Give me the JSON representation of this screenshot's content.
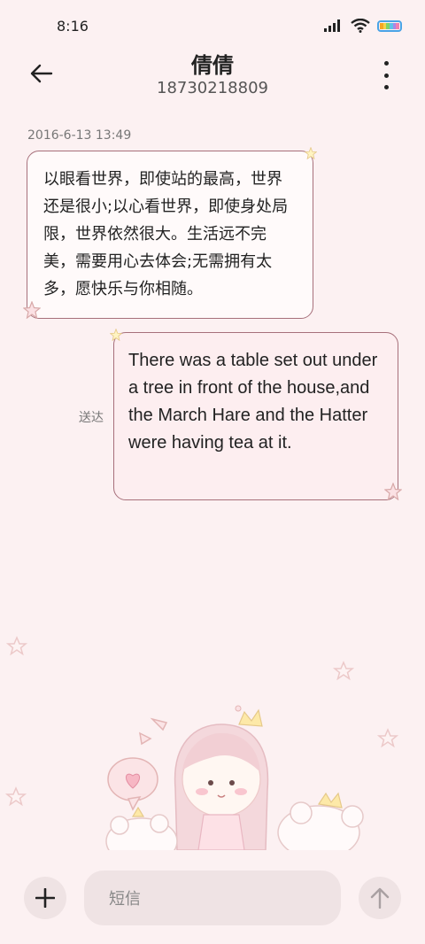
{
  "status_bar": {
    "time": "8:16",
    "icons": [
      "signal-icon",
      "wifi-icon",
      "battery-icon"
    ]
  },
  "header": {
    "contact_name": "倩倩",
    "phone_number": "18730218809"
  },
  "conversation": {
    "timestamp": "2016-6-13 13:49",
    "incoming_message": "以眼看世界，即使站的最高，世界还是很小;以心看世界，即使身处局限，世界依然很大。生活远不完美，需要用心去体会;无需拥有太多，愿快乐与你相随。",
    "outgoing_message": "There was a table set out under a tree in front of the house,and the March Hare and the Hatter were having tea at it.",
    "outgoing_status": "送达"
  },
  "composer": {
    "placeholder": "短信"
  },
  "colors": {
    "background": "#fcf1f2",
    "bubble_border": "#a7707b",
    "incoming_bubble": "#fffafa",
    "outgoing_bubble": "#fdeef0",
    "battery": "#4aa3e6"
  }
}
